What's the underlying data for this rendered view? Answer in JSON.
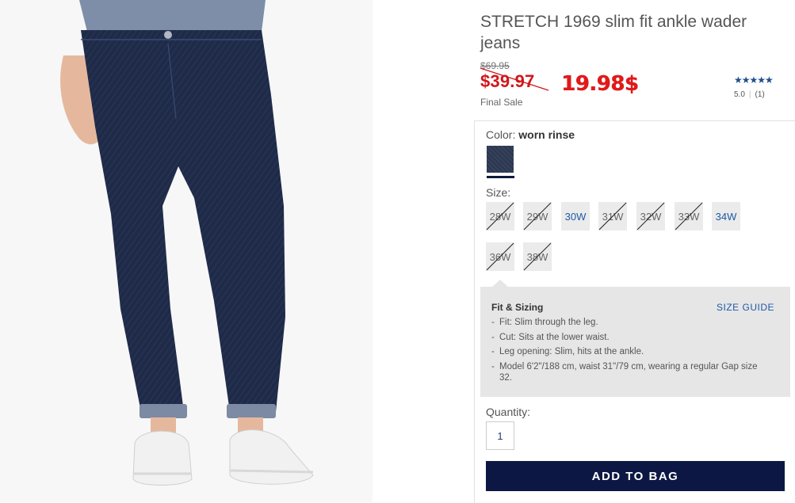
{
  "product": {
    "title": "STRETCH 1969 slim fit ankle wader jeans",
    "original_price": "$69.95",
    "sale_price": "$39.97",
    "handwritten_price": "19.98$",
    "final_sale": "Final Sale",
    "rating": {
      "stars": "★★★★★",
      "value": "5.0",
      "count": "(1)"
    }
  },
  "color": {
    "label": "Color:",
    "value": "worn rinse",
    "swatch_color": "#2b3650"
  },
  "size": {
    "label": "Size:",
    "options": [
      {
        "label": "28W",
        "available": false
      },
      {
        "label": "29W",
        "available": false
      },
      {
        "label": "30W",
        "available": true
      },
      {
        "label": "31W",
        "available": false
      },
      {
        "label": "32W",
        "available": false
      },
      {
        "label": "33W",
        "available": false
      },
      {
        "label": "34W",
        "available": true
      },
      {
        "label": "36W",
        "available": false
      },
      {
        "label": "38W",
        "available": false
      }
    ]
  },
  "fit": {
    "title": "Fit & Sizing",
    "size_guide": "SIZE GUIDE",
    "items": [
      "Fit: Slim through the leg.",
      "Cut: Sits at the lower waist.",
      "Leg opening: Slim, hits at the ankle.",
      "Model 6'2\"/188 cm, waist 31\"/79 cm, wearing a regular Gap size 32."
    ]
  },
  "quantity": {
    "label": "Quantity:",
    "value": "1"
  },
  "add_to_bag": "ADD TO BAG",
  "colors": {
    "accent_red": "#d1171c",
    "link_blue": "#1f5aa6",
    "button_navy": "#0c1744"
  }
}
